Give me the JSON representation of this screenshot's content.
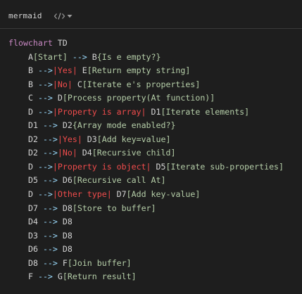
{
  "header": {
    "language_label": "mermaid",
    "code_toggle_icon": "code-brackets-icon",
    "dropdown_icon": "chevron-down-icon"
  },
  "colors": {
    "keyword": "#c586c0",
    "node_id": "#d4d4d4",
    "arrow": "#9cdcfe",
    "node_text": "#b5cea8",
    "edge_label": "#f14c4c",
    "background": "#1e1e1e"
  },
  "code": {
    "lines": [
      [
        {
          "t": "kw",
          "v": "flowchart"
        },
        {
          "t": "nid",
          "v": " TD"
        }
      ],
      [
        {
          "t": "ind",
          "v": ""
        },
        {
          "t": "nid",
          "v": "A"
        },
        {
          "t": "node",
          "v": "[Start]"
        },
        {
          "t": "arr",
          "v": " --> "
        },
        {
          "t": "nid",
          "v": "B"
        },
        {
          "t": "node",
          "v": "{Is e empty?}"
        }
      ],
      [
        {
          "t": "ind",
          "v": ""
        },
        {
          "t": "nid",
          "v": "B "
        },
        {
          "t": "arr",
          "v": "-->"
        },
        {
          "t": "lbl",
          "v": "|Yes|"
        },
        {
          "t": "nid",
          "v": " E"
        },
        {
          "t": "node",
          "v": "[Return empty string]"
        }
      ],
      [
        {
          "t": "ind",
          "v": ""
        },
        {
          "t": "nid",
          "v": "B "
        },
        {
          "t": "arr",
          "v": "-->"
        },
        {
          "t": "lbl",
          "v": "|No|"
        },
        {
          "t": "nid",
          "v": " C"
        },
        {
          "t": "node",
          "v": "[Iterate e's properties]"
        }
      ],
      [
        {
          "t": "ind",
          "v": ""
        },
        {
          "t": "nid",
          "v": "C "
        },
        {
          "t": "arr",
          "v": "-->"
        },
        {
          "t": "nid",
          "v": " D"
        },
        {
          "t": "node",
          "v": "[Process property(At function)]"
        }
      ],
      [
        {
          "t": "ind",
          "v": ""
        },
        {
          "t": "nid",
          "v": "D "
        },
        {
          "t": "arr",
          "v": "-->"
        },
        {
          "t": "lbl",
          "v": "|Property is array|"
        },
        {
          "t": "nid",
          "v": " D1"
        },
        {
          "t": "node",
          "v": "[Iterate elements]"
        }
      ],
      [
        {
          "t": "ind",
          "v": ""
        },
        {
          "t": "nid",
          "v": "D1 "
        },
        {
          "t": "arr",
          "v": "-->"
        },
        {
          "t": "nid",
          "v": " D2"
        },
        {
          "t": "node",
          "v": "{Array mode enabled?}"
        }
      ],
      [
        {
          "t": "ind",
          "v": ""
        },
        {
          "t": "nid",
          "v": "D2 "
        },
        {
          "t": "arr",
          "v": "-->"
        },
        {
          "t": "lbl",
          "v": "|Yes|"
        },
        {
          "t": "nid",
          "v": " D3"
        },
        {
          "t": "node",
          "v": "[Add key=value]"
        }
      ],
      [
        {
          "t": "ind",
          "v": ""
        },
        {
          "t": "nid",
          "v": "D2 "
        },
        {
          "t": "arr",
          "v": "-->"
        },
        {
          "t": "lbl",
          "v": "|No|"
        },
        {
          "t": "nid",
          "v": " D4"
        },
        {
          "t": "node",
          "v": "[Recursive child]"
        }
      ],
      [
        {
          "t": "ind",
          "v": ""
        },
        {
          "t": "nid",
          "v": "D "
        },
        {
          "t": "arr",
          "v": "-->"
        },
        {
          "t": "lbl",
          "v": "|Property is object|"
        },
        {
          "t": "nid",
          "v": " D5"
        },
        {
          "t": "node",
          "v": "[Iterate sub-properties]"
        }
      ],
      [
        {
          "t": "ind",
          "v": ""
        },
        {
          "t": "nid",
          "v": "D5 "
        },
        {
          "t": "arr",
          "v": "-->"
        },
        {
          "t": "nid",
          "v": " D6"
        },
        {
          "t": "node",
          "v": "[Recursive call At]"
        }
      ],
      [
        {
          "t": "ind",
          "v": ""
        },
        {
          "t": "nid",
          "v": "D "
        },
        {
          "t": "arr",
          "v": "-->"
        },
        {
          "t": "lbl",
          "v": "|Other type|"
        },
        {
          "t": "nid",
          "v": " D7"
        },
        {
          "t": "node",
          "v": "[Add key-value]"
        }
      ],
      [
        {
          "t": "ind",
          "v": ""
        },
        {
          "t": "nid",
          "v": "D7 "
        },
        {
          "t": "arr",
          "v": "-->"
        },
        {
          "t": "nid",
          "v": " D8"
        },
        {
          "t": "node",
          "v": "[Store to buffer]"
        }
      ],
      [
        {
          "t": "ind",
          "v": ""
        },
        {
          "t": "nid",
          "v": "D4 "
        },
        {
          "t": "arr",
          "v": "-->"
        },
        {
          "t": "nid",
          "v": " D8"
        }
      ],
      [
        {
          "t": "ind",
          "v": ""
        },
        {
          "t": "nid",
          "v": "D3 "
        },
        {
          "t": "arr",
          "v": "-->"
        },
        {
          "t": "nid",
          "v": " D8"
        }
      ],
      [
        {
          "t": "ind",
          "v": ""
        },
        {
          "t": "nid",
          "v": "D6 "
        },
        {
          "t": "arr",
          "v": "-->"
        },
        {
          "t": "nid",
          "v": " D8"
        }
      ],
      [
        {
          "t": "ind",
          "v": ""
        },
        {
          "t": "nid",
          "v": "D8 "
        },
        {
          "t": "arr",
          "v": "-->"
        },
        {
          "t": "nid",
          "v": " F"
        },
        {
          "t": "node",
          "v": "[Join buffer]"
        }
      ],
      [
        {
          "t": "ind",
          "v": ""
        },
        {
          "t": "nid",
          "v": "F "
        },
        {
          "t": "arr",
          "v": "-->"
        },
        {
          "t": "nid",
          "v": " G"
        },
        {
          "t": "node",
          "v": "[Return result]"
        }
      ]
    ]
  }
}
